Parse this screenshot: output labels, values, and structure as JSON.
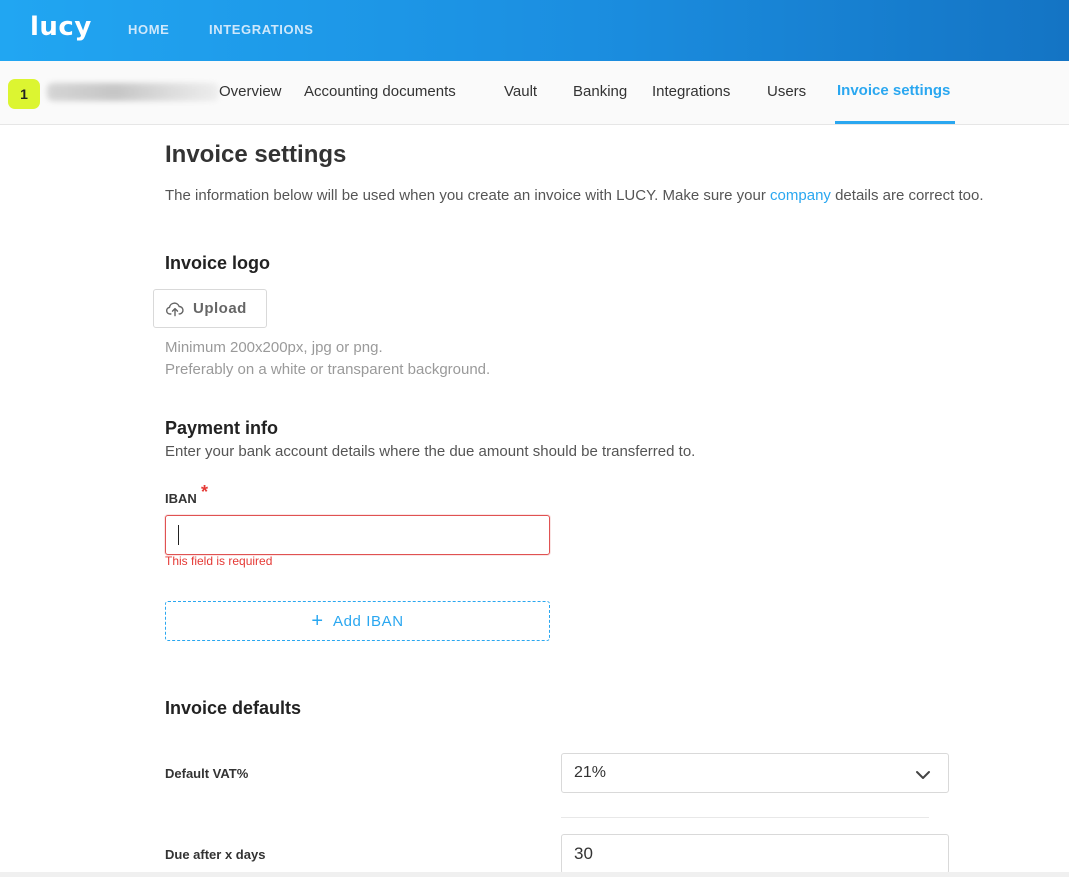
{
  "topbar": {
    "logo": "lucy",
    "nav": [
      "HOME",
      "INTEGRATIONS"
    ]
  },
  "subnav": {
    "badge": "1",
    "tabs": [
      "Overview",
      "Accounting documents",
      "Vault",
      "Banking",
      "Integrations",
      "Users",
      "Invoice settings"
    ],
    "active_tab": "Invoice settings"
  },
  "page": {
    "title": "Invoice settings",
    "intro_before": "The information below will be used when you create an invoice with LUCY. Make sure your ",
    "intro_link": "company",
    "intro_after": " details are correct too."
  },
  "logo_section": {
    "heading": "Invoice logo",
    "upload_label": "Upload",
    "upload_icon": "cloud-upload-icon",
    "hint_1": "Minimum 200x200px, jpg or png.",
    "hint_2": "Preferably on a white or transparent background."
  },
  "payment": {
    "heading": "Payment info",
    "description": "Enter your bank account details where the due amount should be transferred to.",
    "iban_label": "IBAN",
    "required_marker": "*",
    "iban_value": "",
    "error": "This field is required",
    "add_iban_label": "Add IBAN",
    "add_iban_icon": "plus-icon"
  },
  "defaults": {
    "heading": "Invoice defaults",
    "vat_label": "Default VAT%",
    "vat_value": "21%",
    "due_label": "Due after x days",
    "due_value": "30"
  },
  "colors": {
    "brand_blue": "#21a6f2",
    "accent": "#2aa7f0",
    "badge": "#dcf531",
    "error": "#e53935"
  }
}
